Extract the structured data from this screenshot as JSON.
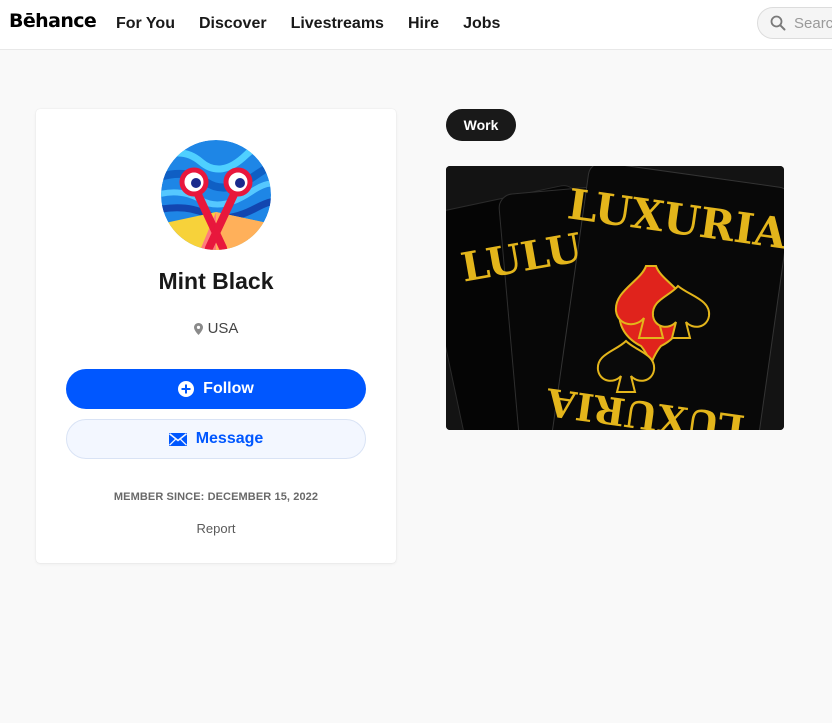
{
  "header": {
    "logo_text": "Bēhance",
    "nav": [
      "For You",
      "Discover",
      "Livestreams",
      "Hire",
      "Jobs"
    ],
    "search_placeholder": "Search"
  },
  "profile": {
    "name": "Mint Black",
    "location": "USA",
    "follow_label": "Follow",
    "message_label": "Message",
    "member_since": "MEMBER SINCE: DECEMBER 15, 2022",
    "report_label": "Report"
  },
  "work": {
    "tab_label": "Work",
    "project": {
      "cover_text_main": "LUXURIA",
      "cover_text_left": "LULU",
      "cover_text_bottom": "LUXURIA"
    }
  },
  "colors": {
    "accent": "#0057ff",
    "nav_text": "#191919",
    "page_bg": "#f9f9f9",
    "cover_gold": "#e3b51b",
    "cover_red": "#e0231c"
  },
  "icons": [
    "search-icon",
    "location-pin-icon",
    "plus-circle-icon",
    "envelope-icon"
  ]
}
